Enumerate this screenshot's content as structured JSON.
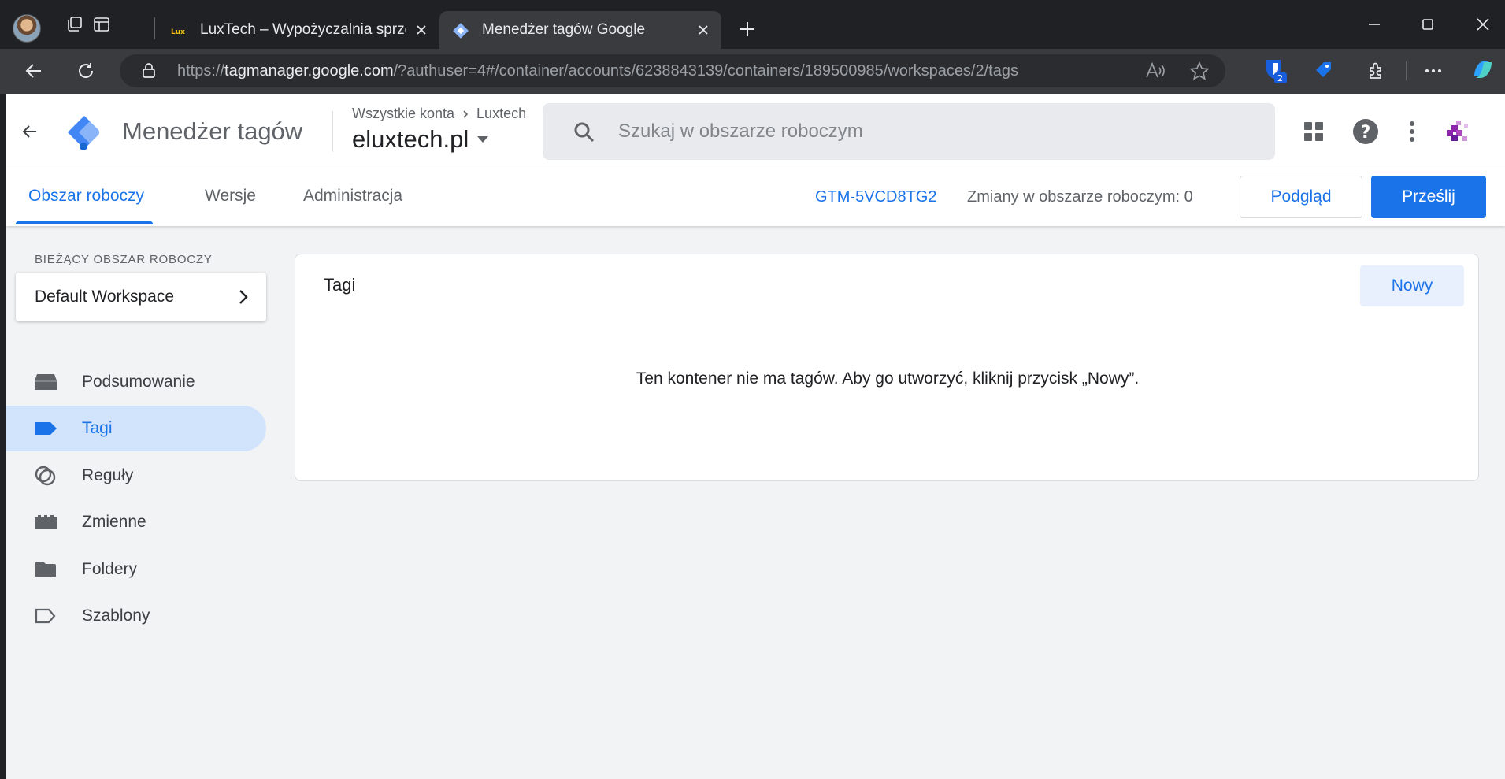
{
  "browser": {
    "tabs": [
      {
        "title": "LuxTech – Wypożyczalnia sprzętu",
        "favicon": "luxtech-favicon",
        "active": false
      },
      {
        "title": "Menedżer tagów Google",
        "favicon": "gtm-favicon",
        "active": true
      }
    ],
    "url": {
      "scheme": "https://",
      "host": "tagmanager.google.com",
      "path": "/?authuser=4#/container/accounts/6238843139/containers/189500985/workspaces/2/tags"
    },
    "extension_badge": "2",
    "colors": {
      "chrome_dark": "#202124",
      "toolbar": "#3a3b3e"
    }
  },
  "header": {
    "product_name": "Menedżer tagów",
    "breadcrumb": {
      "account_root": "Wszystkie konta",
      "account": "Luxtech"
    },
    "container": "eluxtech.pl",
    "search_placeholder": "Szukaj w obszarze roboczym"
  },
  "subnav": {
    "tabs": [
      {
        "label": "Obszar roboczy",
        "active": true
      },
      {
        "label": "Wersje",
        "active": false
      },
      {
        "label": "Administracja",
        "active": false
      }
    ],
    "container_id": "GTM-5VCD8TG2",
    "changes_text": "Zmiany w obszarze roboczym: 0",
    "preview_label": "Podgląd",
    "submit_label": "Prześlij"
  },
  "sidebar": {
    "workspace_heading": "BIEŻĄCY OBSZAR ROBOCZY",
    "workspace_name": "Default Workspace",
    "items": [
      {
        "label": "Podsumowanie",
        "icon": "overview-icon",
        "active": false
      },
      {
        "label": "Tagi",
        "icon": "tag-icon",
        "active": true
      },
      {
        "label": "Reguły",
        "icon": "trigger-icon",
        "active": false
      },
      {
        "label": "Zmienne",
        "icon": "variable-icon",
        "active": false
      },
      {
        "label": "Foldery",
        "icon": "folder-icon",
        "active": false
      },
      {
        "label": "Szablony",
        "icon": "template-icon",
        "active": false
      }
    ]
  },
  "tags_card": {
    "title": "Tagi",
    "new_button": "Nowy",
    "empty_message": "Ten kontener nie ma tagów. Aby go utworzyć, kliknij przycisk „Nowy”."
  },
  "colors": {
    "accent": "#1a73e8",
    "active_nav_bg": "#d2e3fc",
    "page_bg": "#f1f3f4"
  }
}
